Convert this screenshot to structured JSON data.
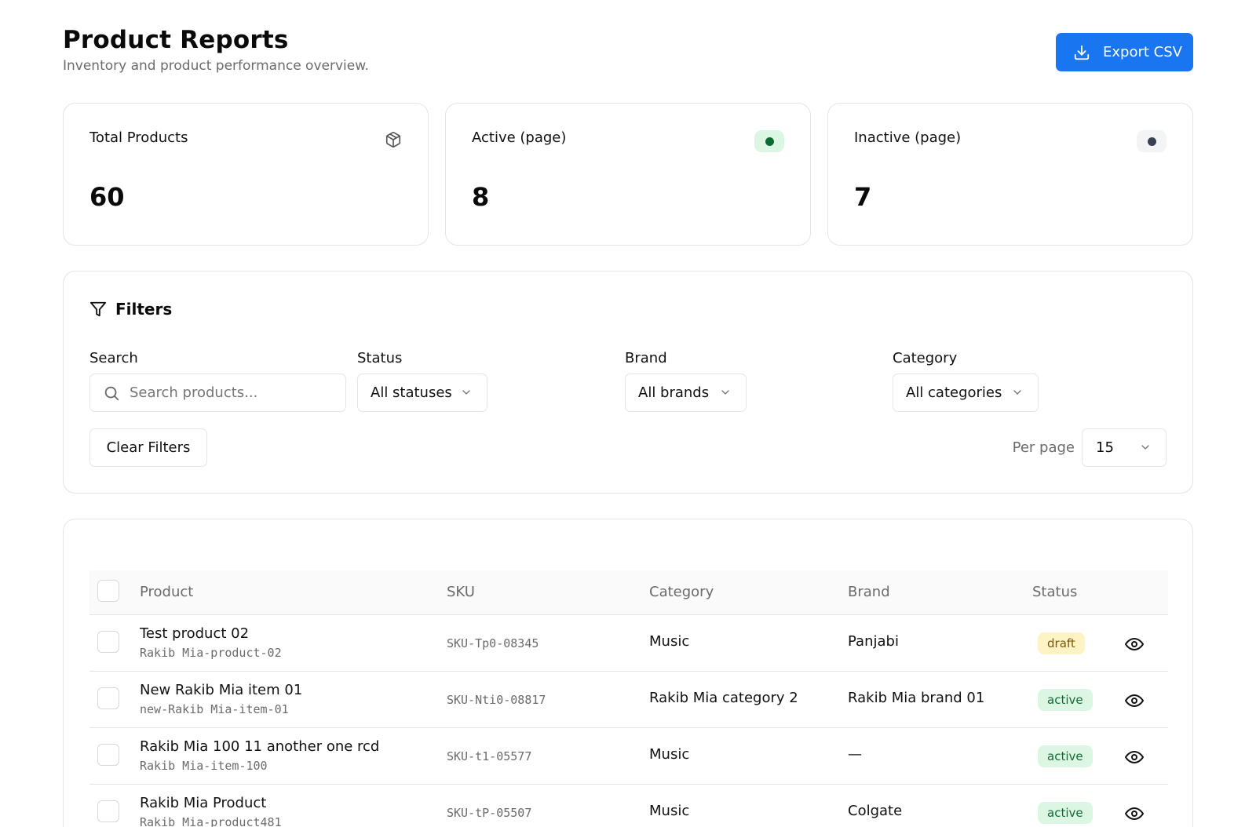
{
  "header": {
    "title": "Product Reports",
    "subtitle": "Inventory and product performance overview.",
    "export_label": "Export CSV"
  },
  "stats": [
    {
      "label": "Total Products",
      "value": "60",
      "icon": "box-icon"
    },
    {
      "label": "Active (page)",
      "value": "8",
      "indicator_color": "#0b6b33",
      "indicator_bg": "#dcf6e4"
    },
    {
      "label": "Inactive (page)",
      "value": "7",
      "indicator_color": "#374151",
      "indicator_bg": "#f3f4f6"
    }
  ],
  "filters": {
    "title": "Filters",
    "search_label": "Search",
    "search_placeholder": "Search products...",
    "status_label": "Status",
    "status_value": "All statuses",
    "brand_label": "Brand",
    "brand_value": "All brands",
    "category_label": "Category",
    "category_value": "All categories",
    "clear_label": "Clear Filters",
    "per_page_label": "Per page",
    "per_page_value": "15"
  },
  "table": {
    "headers": {
      "product": "Product",
      "sku": "SKU",
      "category": "Category",
      "brand": "Brand",
      "status": "Status"
    },
    "rows": [
      {
        "name": "Test product 02",
        "slug": "Rakib Mia-product-02",
        "sku": "SKU-Tp0-08345",
        "category": "Music",
        "brand": "Panjabi",
        "status": "draft"
      },
      {
        "name": "New Rakib Mia item 01",
        "slug": "new-Rakib Mia-item-01",
        "sku": "SKU-Nti0-08817",
        "category": "Rakib Mia category 2",
        "brand": "Rakib Mia brand 01",
        "status": "active"
      },
      {
        "name": "Rakib Mia 100 11 another one rcd",
        "slug": "Rakib Mia-item-100",
        "sku": "SKU-t1-05577",
        "category": "Music",
        "brand": "—",
        "status": "active"
      },
      {
        "name": "Rakib Mia Product",
        "slug": "Rakib Mia-product481",
        "sku": "SKU-tP-05507",
        "category": "Music",
        "brand": "Colgate",
        "status": "active"
      }
    ]
  },
  "colors": {
    "primary": "#1976f0",
    "border": "#e5e5e5",
    "muted": "#6b6b6b"
  }
}
